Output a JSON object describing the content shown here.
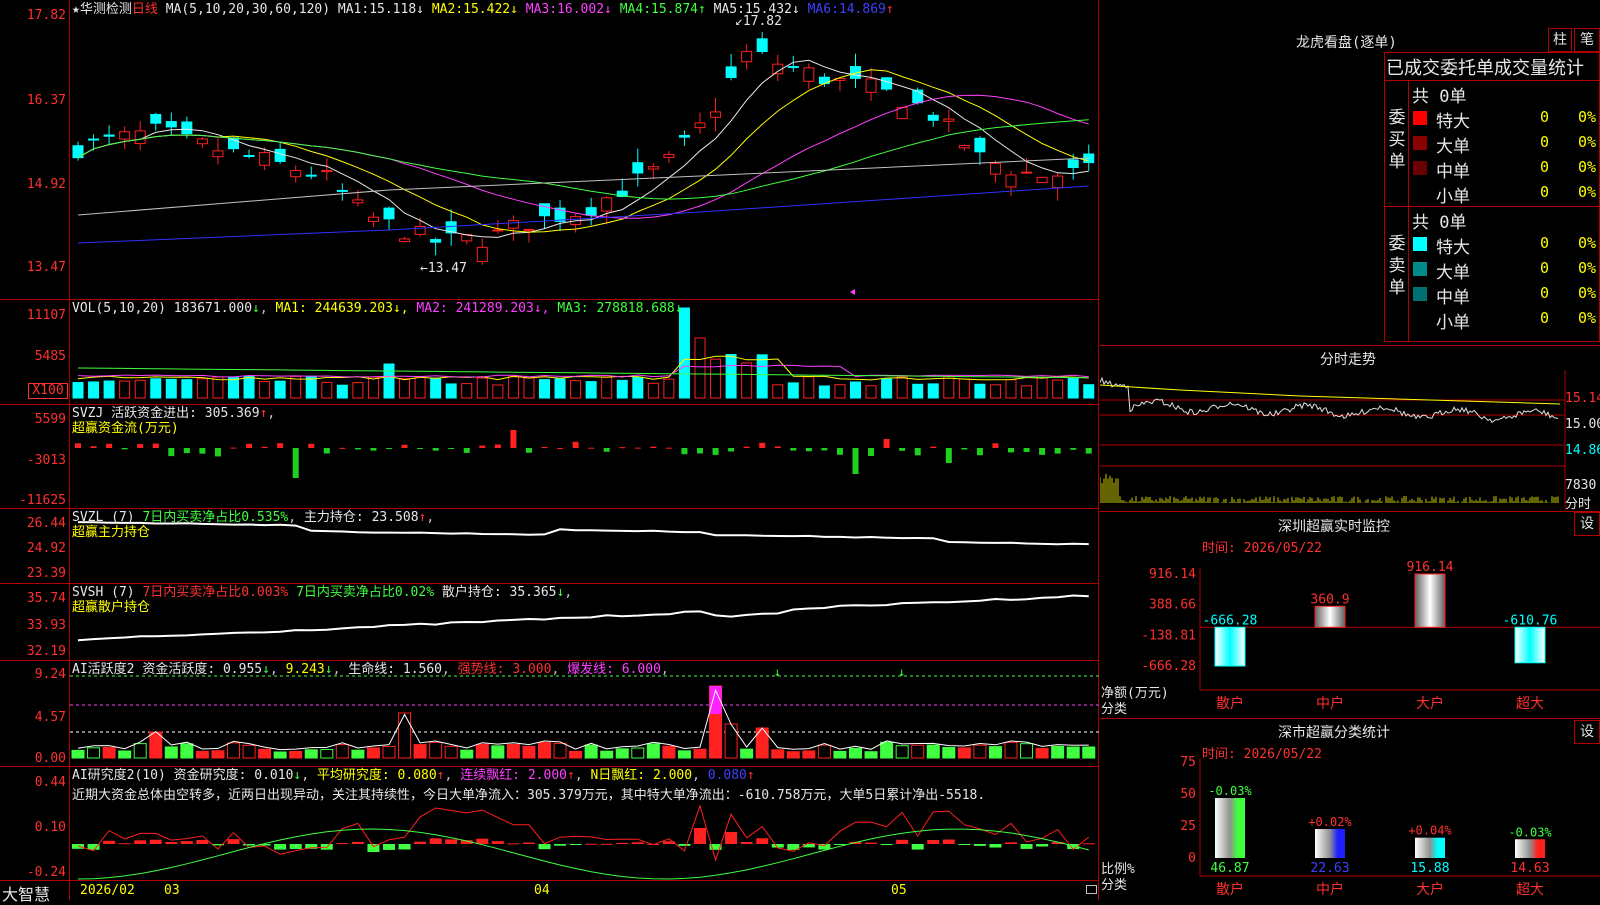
{
  "colors": {
    "up": "#ff2020",
    "down": "#00ffff",
    "grid": "#b00000",
    "ma1": "#e8e8e8",
    "ma2": "#ffff00",
    "ma3": "#ff40ff",
    "ma4": "#40ff40",
    "ma5": "#c0c0c0",
    "ma6": "#3030ff",
    "dline": "#c00000"
  },
  "kline": {
    "star": "★",
    "stock_name": "华测检测",
    "period": "日线",
    "ma_params": "MA(5,10,20,30,60,120)",
    "ma_values": [
      {
        "label": "MA1:",
        "value": "15.118",
        "arrow": "↓"
      },
      {
        "label": "MA2:",
        "value": "15.422",
        "arrow": "↓"
      },
      {
        "label": "MA3:",
        "value": "16.002",
        "arrow": "↓"
      },
      {
        "label": "MA4:",
        "value": "15.874",
        "arrow": "↑"
      },
      {
        "label": "MA5:",
        "value": "15.432",
        "arrow": "↓"
      },
      {
        "label": "MA6:",
        "value": "14.869",
        "arrow": "↑"
      }
    ],
    "y_ticks": [
      "17.82",
      "16.37",
      "14.92",
      "13.47"
    ],
    "high_label": "17.82",
    "low_label": "13.47"
  },
  "vol": {
    "title": "VOL(5,10,20)",
    "value": "183671.000",
    "arrow": "↓",
    "ma1": "244639.203",
    "ma2": "241289.203",
    "ma3": "278818.688",
    "y_ticks": [
      "11107",
      "5485"
    ],
    "unit": "X100"
  },
  "svzj": {
    "title": "SVZJ",
    "label": "活跃资金进出:",
    "value": "305.369",
    "arrow": "↑",
    "sub": "超赢资金流(万元)",
    "y_ticks": [
      "5599",
      "-3013",
      "-11625"
    ]
  },
  "svzl": {
    "title": "SVZL (7)",
    "part1": "7日内买卖净占比0.535%",
    "label": "主力持仓:",
    "value": "23.508",
    "arrow": "↑",
    "sub": "超赢主力持仓",
    "y_ticks": [
      "26.44",
      "24.92",
      "23.39"
    ]
  },
  "svsh": {
    "title": "SVSH (7)",
    "part1": "7日内买卖净占比0.003%",
    "part2": "7日内买卖净占比0.02%",
    "label": "散户持仓:",
    "value": "35.365",
    "arrow": "↓",
    "sub": "超赢散户持仓",
    "y_ticks": [
      "35.74",
      "33.93",
      "32.19"
    ]
  },
  "ai_active": {
    "title": "AI活跃度2",
    "label": "资金活跃度:",
    "value": "0.955",
    "arrow": "↓",
    "v2": "9.243",
    "life_label": "生命线:",
    "life": "1.560",
    "strong": "强势线: 3.000",
    "burst": "爆发线: 6.000",
    "y_ticks": [
      "9.24",
      "4.57",
      "0.00"
    ]
  },
  "ai_research": {
    "title": "AI研究度2(10)",
    "label": "资金研究度:",
    "value": "0.010",
    "avg": "平均研究度: 0.080",
    "cont": "连续飘红: 2.000",
    "nday": "N日飘红: 2.000",
    "last": "0.080",
    "comment": "近期大资金总体由空转多，近两日出现异动，关注其持续性，今日大单净流入：305.379万元，其中特大单净流出：-610.758万元，大单5日累计净出-5518.",
    "y_ticks": [
      "0.44",
      "0.10",
      "-0.24"
    ]
  },
  "footer": {
    "brand": "大智慧",
    "date": "2026/02",
    "months": [
      "03",
      "04",
      "05"
    ]
  },
  "dragon": {
    "title": "龙虎看盘(逐单)",
    "btn1": "柱",
    "btn2": "笔",
    "subtitle": "已成交委托单成交量统计",
    "buy": {
      "label": "委买单",
      "total": "共 0单",
      "rows": [
        {
          "name": "特大",
          "val": "0",
          "pct": "0%",
          "color": "#ff0000"
        },
        {
          "name": "大单",
          "val": "0",
          "pct": "0%",
          "color": "#8b0000"
        },
        {
          "name": "中单",
          "val": "0",
          "pct": "0%",
          "color": "#6a0000"
        },
        {
          "name": "小单",
          "val": "0",
          "pct": "0%",
          "color": ""
        }
      ]
    },
    "sell": {
      "label": "委卖单",
      "total": "共 0单",
      "rows": [
        {
          "name": "特大",
          "val": "0",
          "pct": "0%",
          "color": "#00ffff"
        },
        {
          "name": "大单",
          "val": "0",
          "pct": "0%",
          "color": "#008b8b"
        },
        {
          "name": "中单",
          "val": "0",
          "pct": "0%",
          "color": "#007070"
        },
        {
          "name": "小单",
          "val": "0",
          "pct": "0%",
          "color": ""
        }
      ]
    }
  },
  "minute": {
    "title": "分时走势",
    "ticks": [
      "15.14",
      "15.00",
      "14.86"
    ],
    "vol_tick": "7830",
    "label": "分时"
  },
  "monitor": {
    "title": "深圳超赢实时监控",
    "settings": "设",
    "time": "时间: 2026/05/22",
    "y_ticks": [
      "916.14",
      "388.66",
      "-138.81",
      "-666.28"
    ],
    "ylabel": "净额(万元)",
    "xlabel": "分类",
    "bars": [
      {
        "cat": "散户",
        "value": -666.28,
        "label": "-666.28"
      },
      {
        "cat": "中户",
        "value": 360.9,
        "label": "360.9"
      },
      {
        "cat": "大户",
        "value": 916.14,
        "label": "916.14"
      },
      {
        "cat": "超大",
        "value": -610.76,
        "label": "-610.76"
      }
    ]
  },
  "classify": {
    "title": "深市超赢分类统计",
    "settings": "设",
    "time": "时间: 2026/05/22",
    "y_ticks": [
      "75",
      "50",
      "25",
      "0"
    ],
    "ylabel": "比例%",
    "xlabel": "分类",
    "bars": [
      {
        "cat": "散户",
        "value": 46.87,
        "label": "46.87",
        "chg": "-0.03%",
        "color": "#40ff40"
      },
      {
        "cat": "中户",
        "value": 22.63,
        "label": "22.63",
        "chg": "+0.02%",
        "color": "#2020ff"
      },
      {
        "cat": "大户",
        "value": 15.88,
        "label": "15.88",
        "chg": "+0.04%",
        "color": "#00ffff"
      },
      {
        "cat": "超大",
        "value": 14.63,
        "label": "14.63",
        "chg": "-0.03%",
        "color": "#ff2020"
      }
    ]
  }
}
